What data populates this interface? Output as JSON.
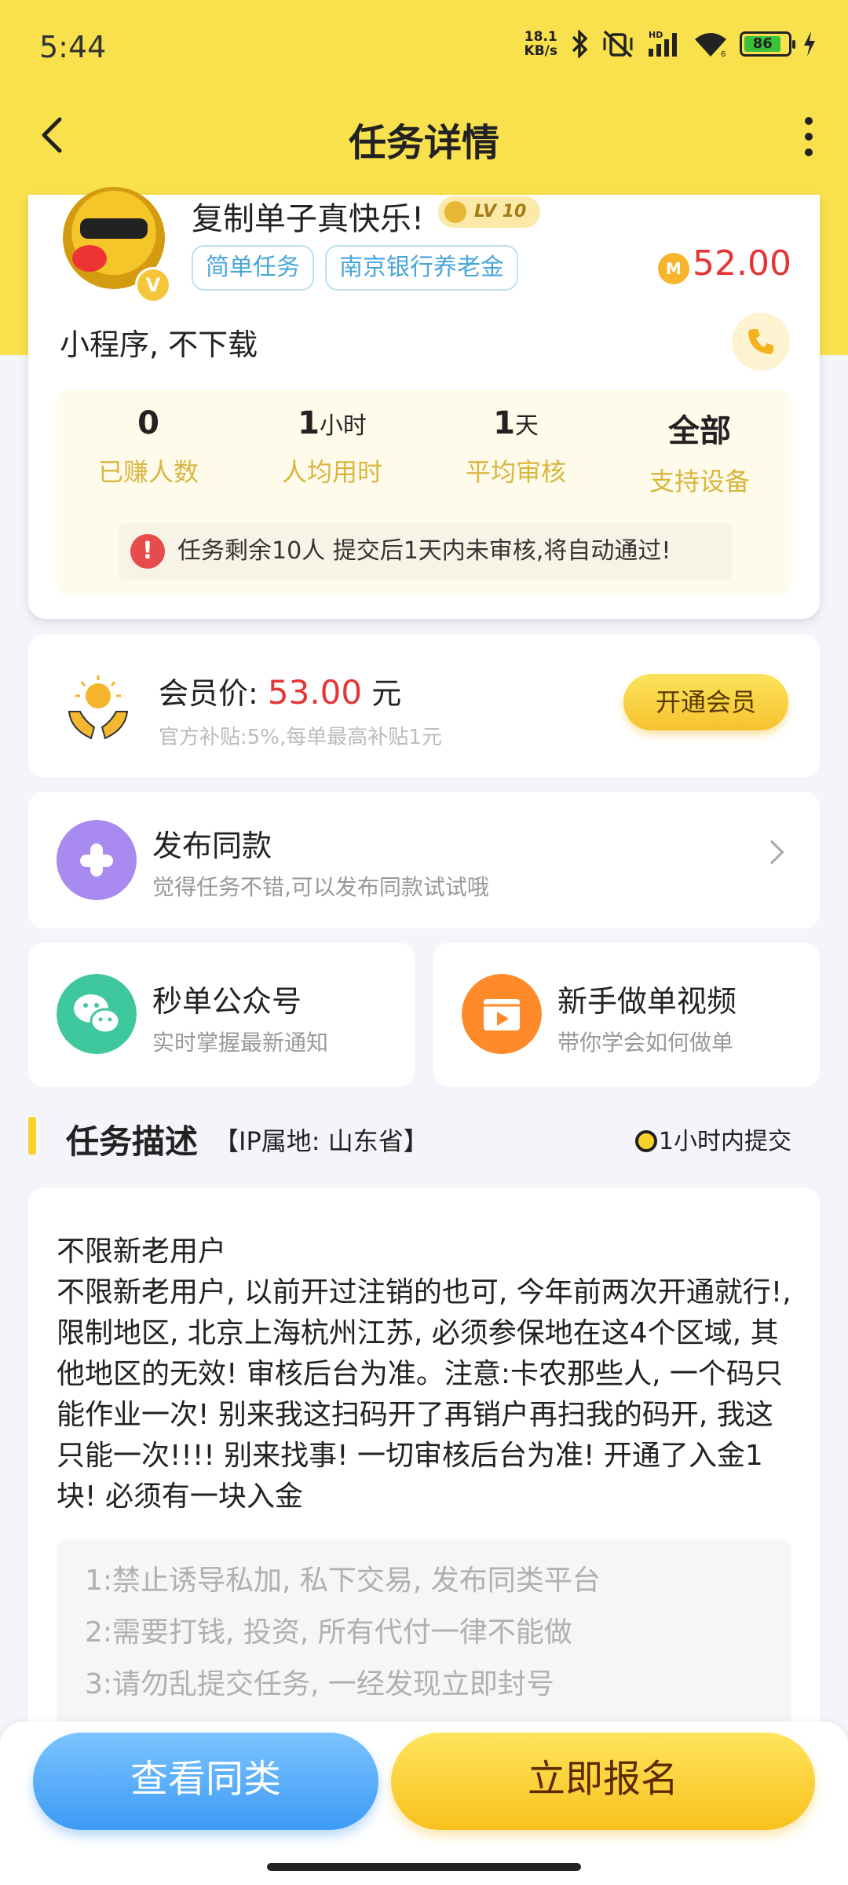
{
  "status": {
    "time": "5:44",
    "netspeed_value": "18.1",
    "netspeed_unit": "KB/s",
    "battery": "86"
  },
  "header": {
    "title": "任务详情"
  },
  "task": {
    "name": "复制单子真快乐!",
    "level": "LV 10",
    "badge": "V",
    "tags": [
      "简单任务",
      "南京银行养老金"
    ],
    "coin_symbol": "M",
    "price": "52.00",
    "subtitle": "小程序, 不下载",
    "stats": [
      {
        "value": "0",
        "unit": "",
        "label": "已赚人数"
      },
      {
        "value": "1",
        "unit": "小时",
        "label": "人均用时"
      },
      {
        "value": "1",
        "unit": "天",
        "label": "平均审核"
      },
      {
        "value": "全部",
        "unit": "",
        "label": "支持设备"
      }
    ],
    "notice": "任务剩余10人  提交后1天内未审核,将自动通过!",
    "notice_icon": "!"
  },
  "member": {
    "label": "会员价: ",
    "price": "53.00",
    "unit": " 元",
    "sub": "官方补贴:5%,每单最高补贴1元",
    "button": "开通会员"
  },
  "publish": {
    "title": "发布同款",
    "sub": "觉得任务不错,可以发布同款试试哦"
  },
  "cards": [
    {
      "title": "秒单公众号",
      "sub": "实时掌握最新通知",
      "color": "#3fc79d"
    },
    {
      "title": "新手做单视频",
      "sub": "带你学会如何做单",
      "color": "#ff8a2a"
    }
  ],
  "description": {
    "title": "任务描述",
    "ip": "【IP属地: 山东省】",
    "time": "1小时内提交",
    "text": "不限新老用户\n不限新老用户, 以前开过注销的也可, 今年前两次开通就行!, 限制地区, 北京上海杭州江苏, 必须参保地在这4个区域, 其他地区的无效! 审核后台为准。注意:卡农那些人, 一个码只能作业一次! 别来我这扫码开了再销户再扫我的码开, 我这只能一次!!!! 别来找事! 一切审核后台为准! 开通了入金1块! 必须有一块入金",
    "rules": [
      "1:禁止诱导私加, 私下交易, 发布同类平台",
      "2:需要打钱, 投资, 所有代付一律不能做",
      "3:请勿乱提交任务, 一经发现立即封号"
    ]
  },
  "bottom": {
    "similar": "查看同类",
    "signup": "立即报名"
  }
}
